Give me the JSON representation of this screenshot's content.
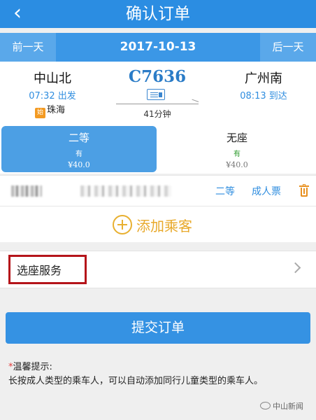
{
  "header": {
    "back_icon": "chevron-left-icon",
    "title": "确认订单"
  },
  "datebar": {
    "prev_label": "前一天",
    "date": "2017-10-13",
    "next_label": "后一天"
  },
  "train": {
    "from_station": "中山北",
    "depart_time": "07:32 出发",
    "from_tag_mark": "始",
    "from_tag_text": "珠海",
    "train_number": "C7636",
    "duration": "41分钟",
    "to_station": "广州南",
    "arrive_time": "08:13 到达"
  },
  "seats": [
    {
      "name": "二等",
      "availability": "有",
      "price": "¥40.0",
      "selected": true
    },
    {
      "name": "无座",
      "availability": "有",
      "price": "¥40.0",
      "selected": false
    }
  ],
  "passenger": {
    "seat_type": "二等",
    "ticket_type": "成人票"
  },
  "add_passenger": {
    "label": "添加乘客"
  },
  "seat_service": {
    "label": "选座服务"
  },
  "submit": {
    "label": "提交订单"
  },
  "tips": {
    "star": "*",
    "title": "温馨提示:",
    "text": "长按成人类型的乘车人，可以自动添加同行儿童类型的乘车人。"
  },
  "watermark": {
    "text": "中山新闻"
  },
  "colors": {
    "primary": "#2b8de2",
    "accent_orange": "#e8a92b",
    "highlight_red": "#b5141a",
    "available_green": "#2b9a2b"
  }
}
